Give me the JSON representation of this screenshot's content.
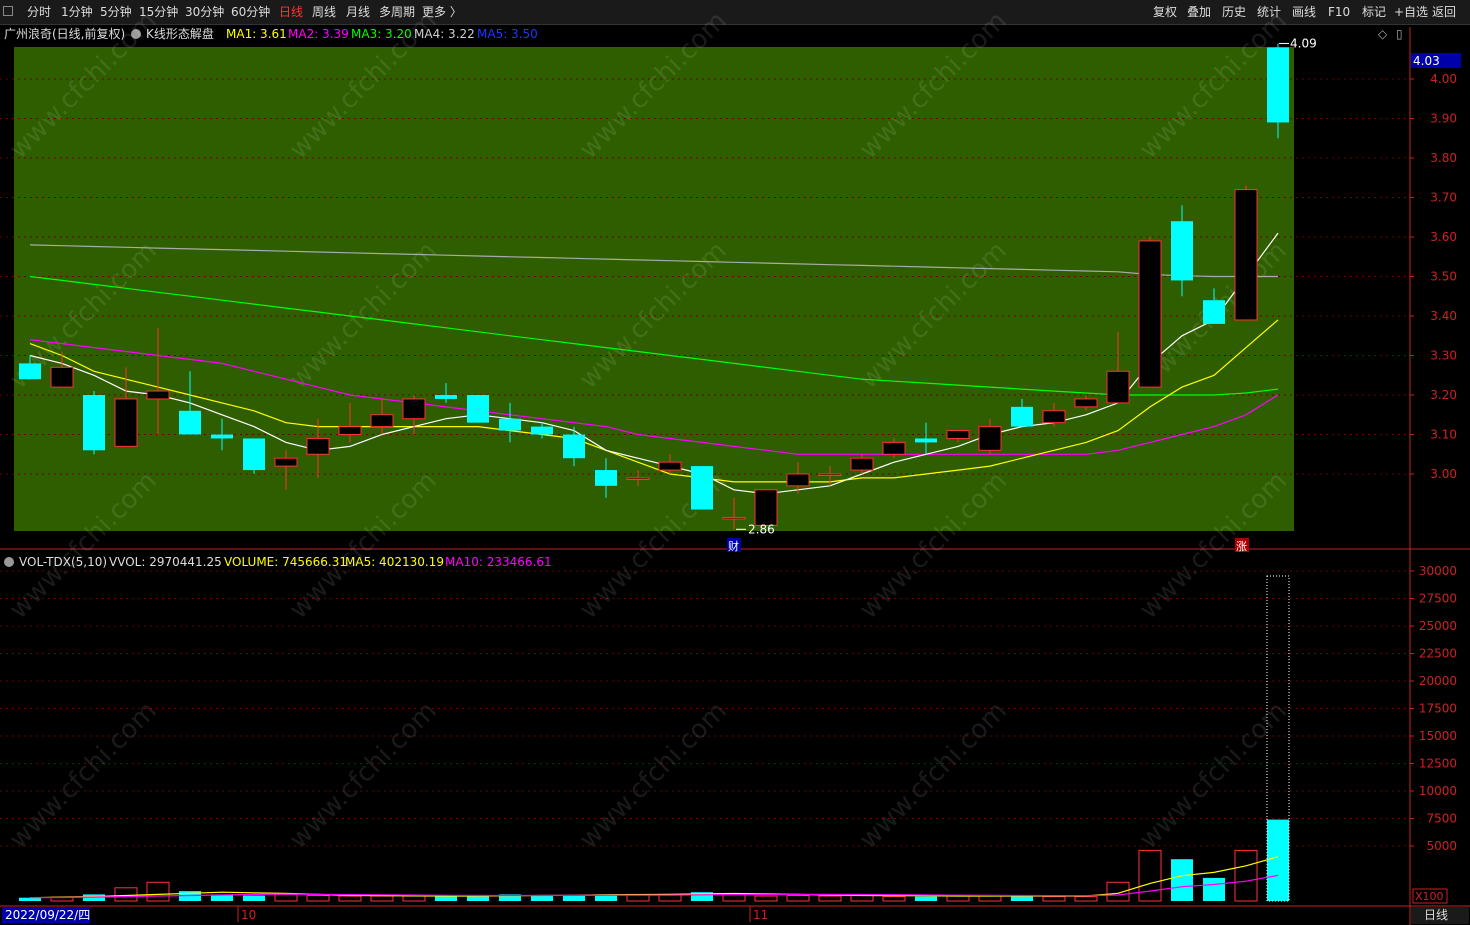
{
  "toolbar": {
    "periods": [
      "分时",
      "1分钟",
      "5分钟",
      "15分钟",
      "30分钟",
      "60分钟",
      "日线",
      "周线",
      "月线",
      "多周期",
      "更多 〉"
    ],
    "active_period": "日线",
    "tools": [
      "复权",
      "叠加",
      "历史",
      "统计",
      "画线",
      "F10",
      "标记",
      "+自选",
      "返回"
    ]
  },
  "header": {
    "stock_name": "广州浪奇",
    "period_note": "(日线,前复权)",
    "indicator_name": "K线形态解盘",
    "ma1": "MA1: 3.61",
    "ma2": "MA2: 3.39",
    "ma3": "MA3: 3.20",
    "ma4": "MA4: 3.22",
    "ma5": "MA5: 3.50"
  },
  "volume_header": {
    "name": "VOL-TDX(5,10)",
    "vvol": "VVOL: 2970441.25",
    "volume": "VOLUME: 745666.31",
    "ma5": "MA5: 402130.19",
    "ma10": "MA10: 233466.61"
  },
  "colors": {
    "chart_bg": "#2e5e00",
    "up": "#ff3333",
    "down": "#00ffff",
    "ma1": "#ffffff",
    "ma2": "#ff00ff",
    "ma3": "#00ff00",
    "ma4": "#ffff00",
    "ma5": "#aaaaaa",
    "vol_ma5": "#ffff00",
    "vol_ma10": "#ff00ff",
    "axis_red": "#cc2222"
  },
  "price_axis": {
    "current_price": "4.03",
    "ticks": [
      "4.00",
      "3.90",
      "3.80",
      "3.70",
      "3.60",
      "3.50",
      "3.40",
      "3.30",
      "3.20",
      "3.10",
      "3.00"
    ]
  },
  "volume_axis": {
    "ticks": [
      "30000",
      "27500",
      "25000",
      "22500",
      "20000",
      "17500",
      "15000",
      "12500",
      "10000",
      "7500",
      "5000"
    ],
    "unit": "X100"
  },
  "markers": {
    "high_label": "4.09",
    "low_label": "2.86",
    "fin_marker": "财",
    "up_marker": "涨"
  },
  "date_axis": {
    "start_date": "2022/09/22/四",
    "month_labels": [
      "10",
      "11"
    ]
  },
  "bottom_right": "日线",
  "watermark": "www.cfchi.com",
  "chart_data": {
    "type": "candlestick",
    "price_range": [
      2.86,
      4.09
    ],
    "candles": [
      {
        "o": 3.28,
        "h": 3.3,
        "l": 3.24,
        "c": 3.24
      },
      {
        "o": 3.22,
        "h": 3.31,
        "l": 3.22,
        "c": 3.27
      },
      {
        "o": 3.2,
        "h": 3.21,
        "l": 3.05,
        "c": 3.06
      },
      {
        "o": 3.07,
        "h": 3.27,
        "l": 3.07,
        "c": 3.19
      },
      {
        "o": 3.19,
        "h": 3.37,
        "l": 3.1,
        "c": 3.21
      },
      {
        "o": 3.16,
        "h": 3.26,
        "l": 3.1,
        "c": 3.1
      },
      {
        "o": 3.1,
        "h": 3.14,
        "l": 3.06,
        "c": 3.09
      },
      {
        "o": 3.09,
        "h": 3.09,
        "l": 3.0,
        "c": 3.01
      },
      {
        "o": 3.02,
        "h": 3.06,
        "l": 2.96,
        "c": 3.04
      },
      {
        "o": 3.05,
        "h": 3.14,
        "l": 2.99,
        "c": 3.09
      },
      {
        "o": 3.1,
        "h": 3.18,
        "l": 3.08,
        "c": 3.12
      },
      {
        "o": 3.12,
        "h": 3.19,
        "l": 3.1,
        "c": 3.15
      },
      {
        "o": 3.14,
        "h": 3.2,
        "l": 3.1,
        "c": 3.19
      },
      {
        "o": 3.2,
        "h": 3.23,
        "l": 3.18,
        "c": 3.19
      },
      {
        "o": 3.2,
        "h": 3.2,
        "l": 3.13,
        "c": 3.13
      },
      {
        "o": 3.14,
        "h": 3.18,
        "l": 3.08,
        "c": 3.11
      },
      {
        "o": 3.12,
        "h": 3.13,
        "l": 3.09,
        "c": 3.1
      },
      {
        "o": 3.1,
        "h": 3.12,
        "l": 3.02,
        "c": 3.04
      },
      {
        "o": 3.01,
        "h": 3.04,
        "l": 2.94,
        "c": 2.97
      },
      {
        "o": 2.99,
        "h": 3.01,
        "l": 2.97,
        "c": 2.99
      },
      {
        "o": 3.01,
        "h": 3.05,
        "l": 3.0,
        "c": 3.03
      },
      {
        "o": 3.02,
        "h": 3.02,
        "l": 2.91,
        "c": 2.91
      },
      {
        "o": 2.89,
        "h": 2.94,
        "l": 2.86,
        "c": 2.89
      },
      {
        "o": 2.87,
        "h": 2.96,
        "l": 2.87,
        "c": 2.96
      },
      {
        "o": 2.97,
        "h": 3.03,
        "l": 2.95,
        "c": 3.0
      },
      {
        "o": 3.0,
        "h": 3.02,
        "l": 2.97,
        "c": 3.0
      },
      {
        "o": 3.01,
        "h": 3.05,
        "l": 3.0,
        "c": 3.04
      },
      {
        "o": 3.05,
        "h": 3.09,
        "l": 3.04,
        "c": 3.08
      },
      {
        "o": 3.09,
        "h": 3.13,
        "l": 3.05,
        "c": 3.08
      },
      {
        "o": 3.09,
        "h": 3.11,
        "l": 3.08,
        "c": 3.11
      },
      {
        "o": 3.06,
        "h": 3.14,
        "l": 3.05,
        "c": 3.12
      },
      {
        "o": 3.17,
        "h": 3.19,
        "l": 3.12,
        "c": 3.12
      },
      {
        "o": 3.13,
        "h": 3.18,
        "l": 3.12,
        "c": 3.16
      },
      {
        "o": 3.17,
        "h": 3.2,
        "l": 3.16,
        "c": 3.19
      },
      {
        "o": 3.18,
        "h": 3.36,
        "l": 3.18,
        "c": 3.26
      },
      {
        "o": 3.22,
        "h": 3.6,
        "l": 3.22,
        "c": 3.59
      },
      {
        "o": 3.64,
        "h": 3.68,
        "l": 3.45,
        "c": 3.49
      },
      {
        "o": 3.44,
        "h": 3.47,
        "l": 3.38,
        "c": 3.38
      },
      {
        "o": 3.39,
        "h": 3.73,
        "l": 3.39,
        "c": 3.72
      },
      {
        "o": 4.08,
        "h": 4.09,
        "l": 3.85,
        "c": 3.89
      }
    ],
    "ma1": [
      3.3,
      3.28,
      3.25,
      3.21,
      3.2,
      3.18,
      3.15,
      3.12,
      3.08,
      3.06,
      3.07,
      3.1,
      3.12,
      3.14,
      3.15,
      3.14,
      3.13,
      3.11,
      3.06,
      3.04,
      3.02,
      3.0,
      2.96,
      2.95,
      2.96,
      2.97,
      3.0,
      3.03,
      3.05,
      3.07,
      3.1,
      3.12,
      3.13,
      3.15,
      3.18,
      3.28,
      3.35,
      3.39,
      3.5,
      3.61
    ],
    "ma2": [
      3.34,
      3.33,
      3.32,
      3.31,
      3.3,
      3.29,
      3.28,
      3.26,
      3.24,
      3.22,
      3.2,
      3.19,
      3.18,
      3.17,
      3.16,
      3.15,
      3.14,
      3.13,
      3.12,
      3.1,
      3.09,
      3.08,
      3.07,
      3.06,
      3.05,
      3.05,
      3.05,
      3.05,
      3.05,
      3.05,
      3.05,
      3.05,
      3.05,
      3.05,
      3.06,
      3.08,
      3.1,
      3.12,
      3.15,
      3.2
    ],
    "ma3": [
      3.5,
      3.49,
      3.48,
      3.47,
      3.46,
      3.45,
      3.44,
      3.43,
      3.42,
      3.41,
      3.4,
      3.39,
      3.38,
      3.37,
      3.36,
      3.35,
      3.34,
      3.33,
      3.32,
      3.31,
      3.3,
      3.29,
      3.28,
      3.27,
      3.26,
      3.25,
      3.24,
      3.235,
      3.23,
      3.225,
      3.22,
      3.215,
      3.21,
      3.205,
      3.2,
      3.2,
      3.2,
      3.2,
      3.205,
      3.215
    ],
    "ma4": [
      3.33,
      3.3,
      3.26,
      3.24,
      3.22,
      3.2,
      3.18,
      3.16,
      3.13,
      3.12,
      3.12,
      3.12,
      3.12,
      3.12,
      3.12,
      3.11,
      3.1,
      3.09,
      3.06,
      3.03,
      3.0,
      2.99,
      2.98,
      2.98,
      2.98,
      2.98,
      2.99,
      2.99,
      3.0,
      3.01,
      3.02,
      3.04,
      3.06,
      3.08,
      3.11,
      3.17,
      3.22,
      3.25,
      3.32,
      3.39
    ],
    "ma5": [
      3.58,
      3.578,
      3.576,
      3.574,
      3.572,
      3.57,
      3.568,
      3.566,
      3.564,
      3.562,
      3.56,
      3.558,
      3.556,
      3.554,
      3.552,
      3.55,
      3.548,
      3.546,
      3.544,
      3.542,
      3.54,
      3.538,
      3.536,
      3.534,
      3.532,
      3.53,
      3.528,
      3.526,
      3.524,
      3.522,
      3.52,
      3.518,
      3.516,
      3.514,
      3.512,
      3.505,
      3.502,
      3.5,
      3.5,
      3.5
    ],
    "volume": [
      300,
      350,
      600,
      1200,
      1700,
      900,
      600,
      500,
      600,
      500,
      450,
      450,
      450,
      450,
      550,
      600,
      550,
      550,
      600,
      600,
      600,
      800,
      600,
      450,
      500,
      450,
      500,
      400,
      400,
      450,
      500,
      450,
      400,
      400,
      1700,
      4600,
      3800,
      2100,
      4600,
      7400
    ],
    "vol_ma5": [
      300,
      350,
      400,
      500,
      600,
      700,
      800,
      750,
      700,
      600,
      500,
      480,
      460,
      450,
      450,
      470,
      500,
      520,
      560,
      580,
      600,
      650,
      680,
      650,
      600,
      550,
      500,
      480,
      470,
      450,
      450,
      450,
      450,
      450,
      700,
      1600,
      2300,
      2600,
      3200,
      4030
    ],
    "vol_ma10": [
      300,
      320,
      350,
      400,
      450,
      500,
      550,
      600,
      620,
      600,
      580,
      560,
      540,
      520,
      500,
      500,
      500,
      510,
      520,
      530,
      540,
      560,
      580,
      590,
      600,
      600,
      590,
      570,
      550,
      530,
      510,
      500,
      490,
      480,
      550,
      900,
      1300,
      1500,
      1800,
      2330
    ],
    "volume_ylim": [
      0,
      30000
    ]
  }
}
